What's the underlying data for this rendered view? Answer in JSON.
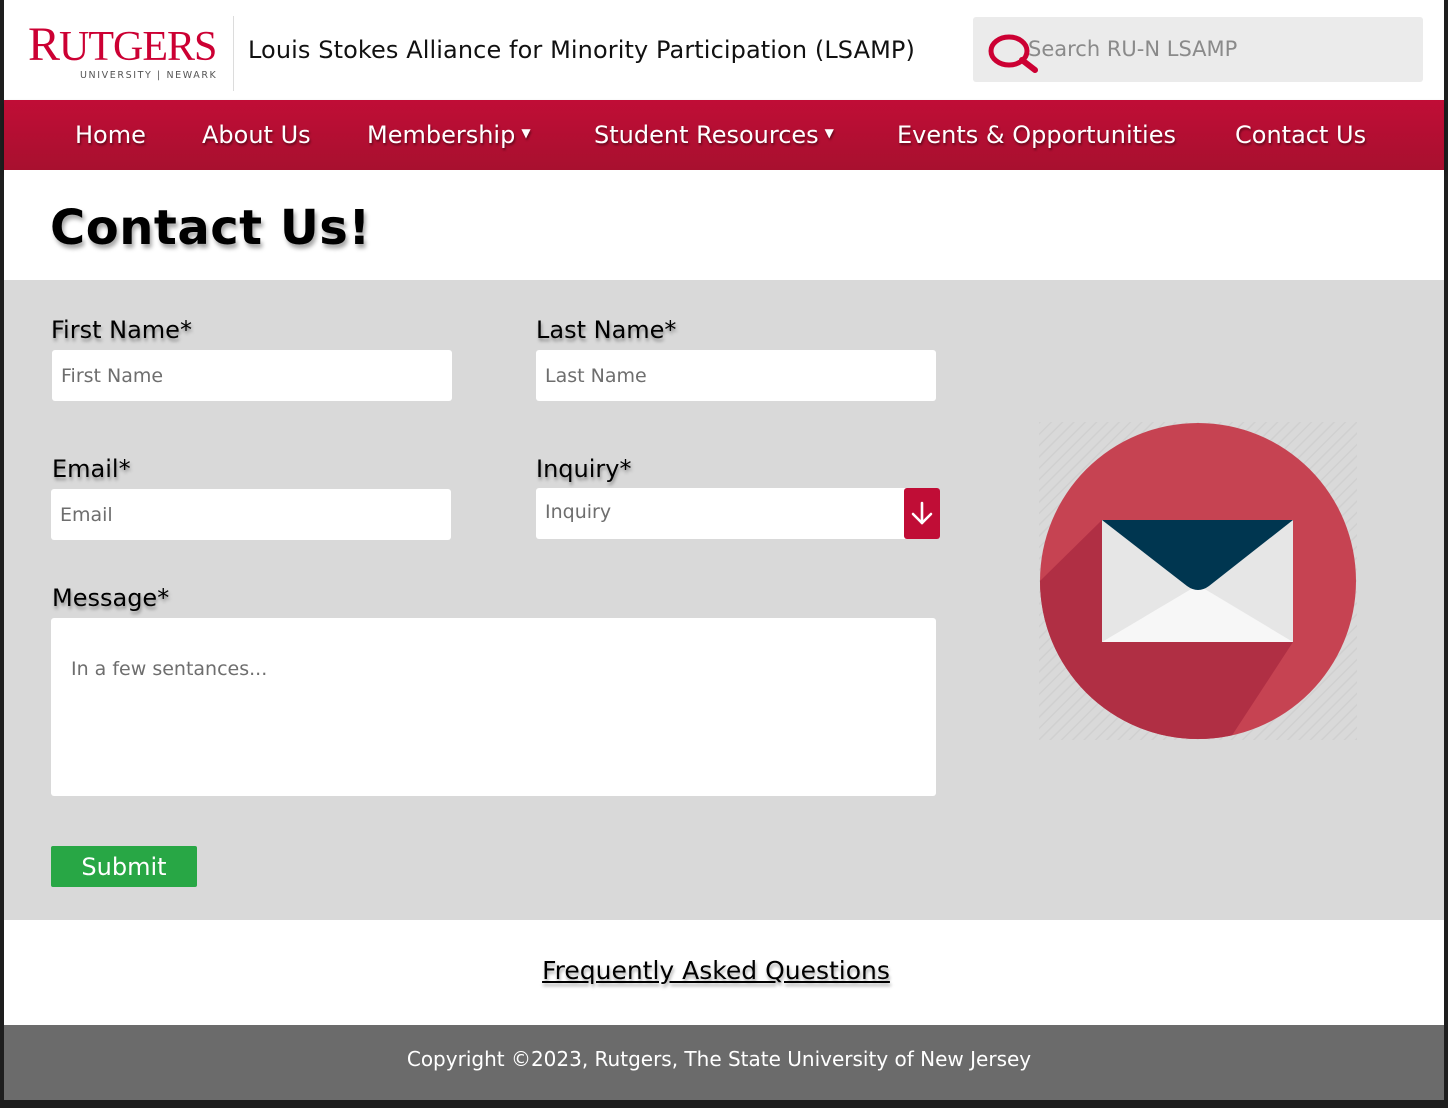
{
  "header": {
    "logo_text_first": "R",
    "logo_text_rest": "UTGERS",
    "logo_subtitle": "UNIVERSITY | NEWARK",
    "site_title": "Louis Stokes Alliance for Minority Participation (LSAMP)",
    "search_placeholder": "Search RU-N LSAMP"
  },
  "nav": {
    "items": [
      {
        "label": "Home"
      },
      {
        "label": "About Us"
      },
      {
        "label": "Membership",
        "caret": "▼"
      },
      {
        "label": "Student Resources",
        "caret": "▼"
      },
      {
        "label": "Events & Opportunities"
      },
      {
        "label": "Contact Us"
      }
    ]
  },
  "page": {
    "title": "Contact Us!"
  },
  "form": {
    "first_name_label": "First Name*",
    "first_name_placeholder": "First Name",
    "last_name_label": "Last Name*",
    "last_name_placeholder": "Last Name",
    "email_label": "Email*",
    "email_placeholder": "Email",
    "inquiry_label": "Inquiry*",
    "inquiry_value": "Inquiry",
    "message_label": "Message*",
    "message_placeholder": "In a few sentances...",
    "submit_label": "Submit"
  },
  "faq": {
    "link_text": "Frequently Asked Questions"
  },
  "footer": {
    "copyright": "Copyright ©2023, Rutgers, The State University of New Jersey"
  },
  "colors": {
    "brand_red": "#cc0033",
    "nav_red": "#b80f33",
    "submit_green": "#28a745",
    "envelope_flap": "#003650"
  },
  "icons": {
    "search": "magnifier-icon",
    "select_arrow": "arrow-down-icon",
    "illustration": "envelope-icon"
  }
}
